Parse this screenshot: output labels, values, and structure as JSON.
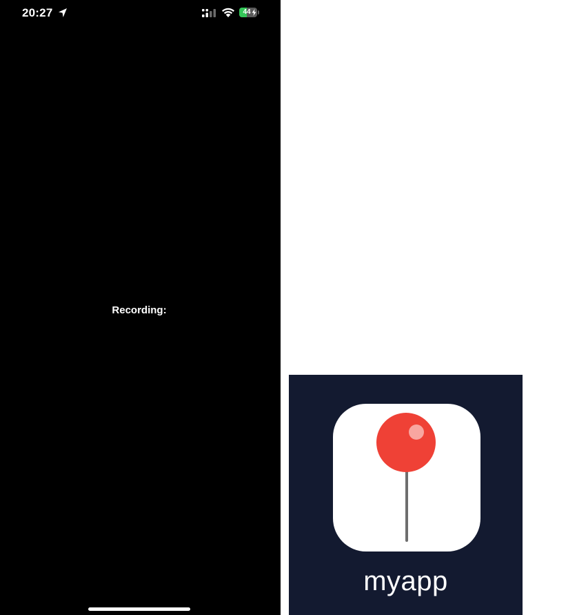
{
  "status_bar": {
    "time": "20:27",
    "location_icon": "location-arrow-icon",
    "signal_icon": "cellular-signal-icon",
    "wifi_icon": "wifi-icon",
    "battery": {
      "level": "44",
      "fraction": 0.44,
      "charging": true,
      "color": "#34c759"
    }
  },
  "screen": {
    "background": "#000000",
    "recording_label": "Recording:"
  },
  "app_icon_panel": {
    "background": "#131a30",
    "icon": "red-map-pin-icon",
    "pin_color": "#ef4136",
    "app_name": "myapp"
  }
}
